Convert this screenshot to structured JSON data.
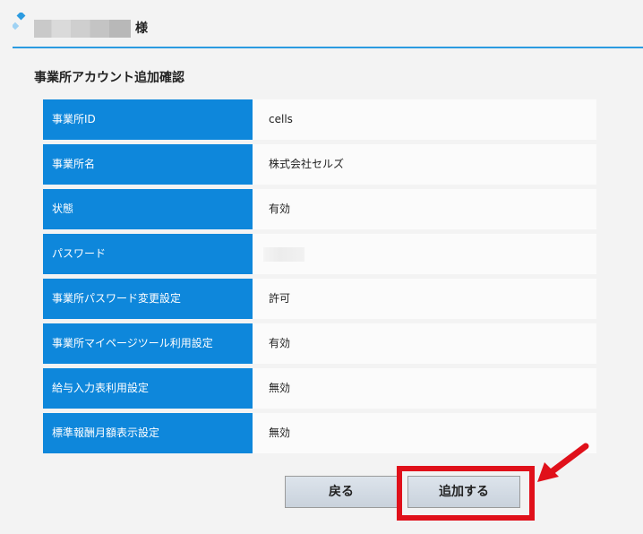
{
  "header": {
    "user_suffix": "様",
    "accent_color": "#2b9be0"
  },
  "section": {
    "title": "事業所アカウント追加確認"
  },
  "details": [
    {
      "label": "事業所ID",
      "value": "cells"
    },
    {
      "label": "事業所名",
      "value": "株式会社セルズ"
    },
    {
      "label": "状態",
      "value": "有効"
    },
    {
      "label": "パスワード",
      "value": ""
    },
    {
      "label": "事業所パスワード変更設定",
      "value": "許可"
    },
    {
      "label": "事業所マイページツール利用設定",
      "value": "有効"
    },
    {
      "label": "給与入力表利用設定",
      "value": "無効"
    },
    {
      "label": "標準報酬月額表示設定",
      "value": "無効"
    }
  ],
  "colors": {
    "label_background": "#0e87db",
    "highlight": "#e0101a"
  },
  "icons": {
    "header_decoration": "diamond-decoration-icon",
    "annotation_arrow": "red-arrow-icon"
  },
  "actions": {
    "back_label": "戻る",
    "add_label": "追加する"
  }
}
